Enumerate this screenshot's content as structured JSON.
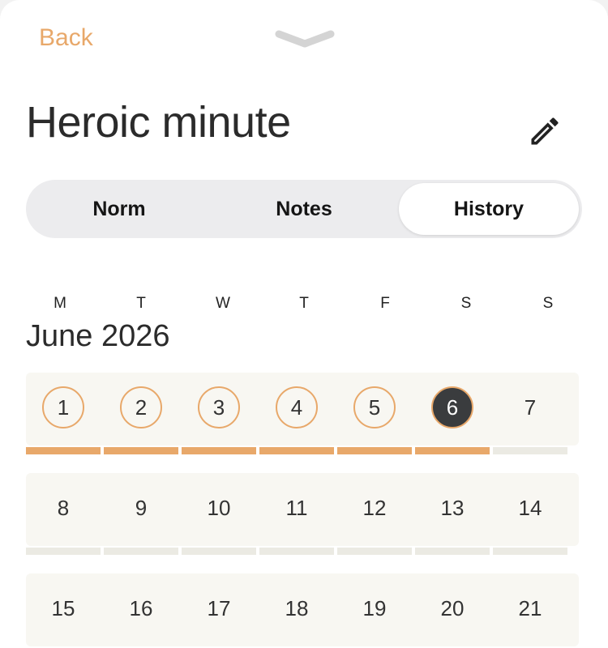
{
  "header": {
    "back_label": "Back"
  },
  "habit": {
    "title": "Heroic minute"
  },
  "tabs": [
    {
      "label": "Norm",
      "active": false
    },
    {
      "label": "Notes",
      "active": false
    },
    {
      "label": "History",
      "active": true
    }
  ],
  "calendar": {
    "weekdays": [
      "M",
      "T",
      "W",
      "T",
      "F",
      "S",
      "S"
    ],
    "month_label": "June 2026",
    "weeks": [
      {
        "days": [
          {
            "day": "1",
            "status": "done"
          },
          {
            "day": "2",
            "status": "done"
          },
          {
            "day": "3",
            "status": "done"
          },
          {
            "day": "4",
            "status": "done"
          },
          {
            "day": "5",
            "status": "done"
          },
          {
            "day": "6",
            "status": "today"
          },
          {
            "day": "7",
            "status": "none"
          }
        ]
      },
      {
        "days": [
          {
            "day": "8",
            "status": "none"
          },
          {
            "day": "9",
            "status": "none"
          },
          {
            "day": "10",
            "status": "none"
          },
          {
            "day": "11",
            "status": "none"
          },
          {
            "day": "12",
            "status": "none"
          },
          {
            "day": "13",
            "status": "none"
          },
          {
            "day": "14",
            "status": "none"
          }
        ]
      },
      {
        "days": [
          {
            "day": "15",
            "status": "none"
          },
          {
            "day": "16",
            "status": "none"
          },
          {
            "day": "17",
            "status": "none"
          },
          {
            "day": "18",
            "status": "none"
          },
          {
            "day": "19",
            "status": "none"
          },
          {
            "day": "20",
            "status": "none"
          },
          {
            "day": "21",
            "status": "none"
          }
        ]
      }
    ]
  },
  "colors": {
    "accent": "#e8a86a",
    "bar_inactive": "#ebeae3",
    "today_fill": "#3a3c3e",
    "week_bg": "#f8f7f2"
  }
}
